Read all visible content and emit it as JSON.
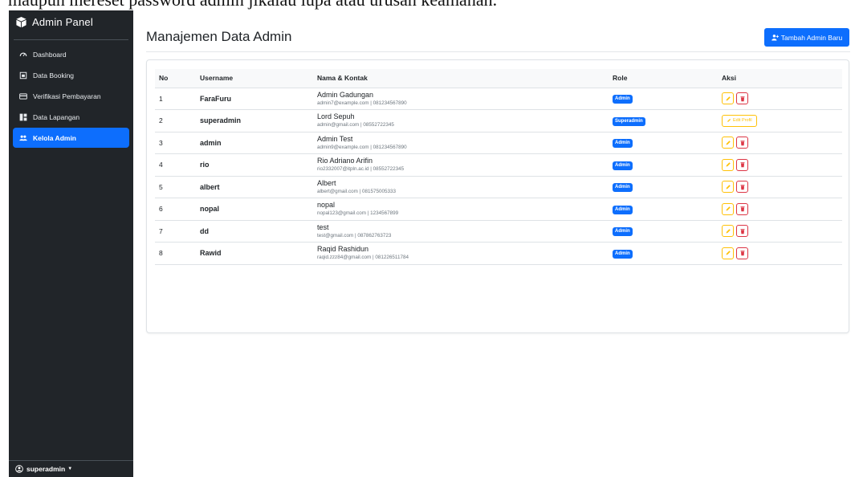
{
  "doc_line": "maupun mereset password admin jikalau lupa atau urusan keamanan.",
  "sidebar": {
    "brand": "Admin Panel",
    "items": [
      {
        "label": "Dashboard",
        "icon": "speedometer-icon",
        "active": false
      },
      {
        "label": "Data Booking",
        "icon": "calendar-icon",
        "active": false
      },
      {
        "label": "Verifikasi Pembayaran",
        "icon": "credit-card-icon",
        "active": false
      },
      {
        "label": "Data Lapangan",
        "icon": "grid-icon",
        "active": false
      },
      {
        "label": "Kelola Admin",
        "icon": "people-icon",
        "active": true
      }
    ],
    "user": "superadmin"
  },
  "header": {
    "title": "Manajemen Data Admin",
    "add_button": "Tambah Admin Baru"
  },
  "table": {
    "columns": {
      "no": "No",
      "username": "Username",
      "nama": "Nama & Kontak",
      "role": "Role",
      "aksi": "Aksi"
    },
    "rows": [
      {
        "no": "1",
        "username": "FaraFuru",
        "nama": "Admin Gadungan",
        "kontak": "admin7@example.com | 081234567890",
        "role": "Admin"
      },
      {
        "no": "2",
        "username": "superadmin",
        "nama": "Lord Sepuh",
        "kontak": "admin@gmail.com | 08552722345",
        "role": "Superadmin",
        "edit_profil": "Edit Profil"
      },
      {
        "no": "3",
        "username": "admin",
        "nama": "Admin Test",
        "kontak": "admin9@example.com | 081234567890",
        "role": "Admin"
      },
      {
        "no": "4",
        "username": "rio",
        "nama": "Rio Adriano Arifin",
        "kontak": "rio2332007@itpln.ac.id | 08552722345",
        "role": "Admin"
      },
      {
        "no": "5",
        "username": "albert",
        "nama": "Albert",
        "kontak": "albert@gmail.com | 081575005333",
        "role": "Admin"
      },
      {
        "no": "6",
        "username": "nopal",
        "nama": "nopal",
        "kontak": "nopal123@gmail.com | 1234567899",
        "role": "Admin"
      },
      {
        "no": "7",
        "username": "dd",
        "nama": "test",
        "kontak": "test@gmail.com | 087862763723",
        "role": "Admin"
      },
      {
        "no": "8",
        "username": "Rawid",
        "nama": "Raqid Rashidun",
        "kontak": "raqid.zzz84@gmail.com | 081226511784",
        "role": "Admin"
      }
    ]
  },
  "colors": {
    "sidebar_bg": "#212529",
    "primary": "#0d6efd",
    "warning": "#ffc107",
    "danger": "#dc3545"
  }
}
